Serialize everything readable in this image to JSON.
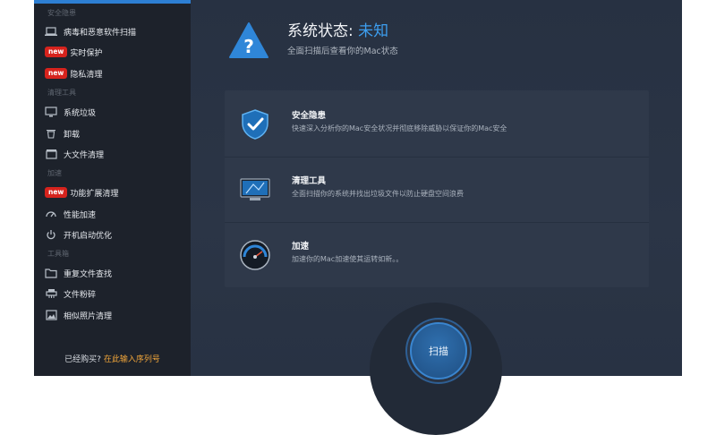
{
  "sidebar": {
    "sections": [
      {
        "title": "安全隐患"
      },
      {
        "title": "清理工具"
      },
      {
        "title": "加速"
      },
      {
        "title": "工具箱"
      }
    ],
    "items": [
      {
        "label": "病毒和恶意软件扫描",
        "icon": "laptop-scan-icon"
      },
      {
        "label": "实时保护",
        "badge": "new"
      },
      {
        "label": "隐私清理",
        "badge": "new"
      },
      {
        "label": "系统垃圾",
        "icon": "monitor-icon"
      },
      {
        "label": "卸载",
        "icon": "trash-icon"
      },
      {
        "label": "大文件清理",
        "icon": "box-icon"
      },
      {
        "label": "功能扩展清理",
        "badge": "new"
      },
      {
        "label": "性能加速",
        "icon": "speed-icon"
      },
      {
        "label": "开机启动优化",
        "icon": "power-icon"
      },
      {
        "label": "重复文件查找",
        "icon": "folder-icon"
      },
      {
        "label": "文件粉碎",
        "icon": "shredder-icon"
      },
      {
        "label": "相似照片清理",
        "icon": "photo-icon"
      }
    ],
    "buy_prefix": "已经购买?",
    "buy_link": "在此输入序列号"
  },
  "status": {
    "title_prefix": "系统状态:",
    "title_value": "未知",
    "subtitle": "全面扫描后查看你的Mac状态"
  },
  "panel": {
    "rows": [
      {
        "title": "安全隐患",
        "desc": "快速深入分析你的Mac安全状况并彻底移除威胁以保证你的Mac安全",
        "icon": "shield-check-icon"
      },
      {
        "title": "清理工具",
        "desc": "全面扫描你的系统并找出垃圾文件以防止硬盘空间浪费",
        "icon": "monitor-clean-icon"
      },
      {
        "title": "加速",
        "desc": "加速你的Mac加速使其运转如新。。",
        "icon": "speedometer-icon"
      }
    ]
  },
  "scan": {
    "label": "扫描"
  },
  "colors": {
    "accent": "#3d9ff0",
    "badge": "#d6231d",
    "link": "#f0a53a"
  }
}
